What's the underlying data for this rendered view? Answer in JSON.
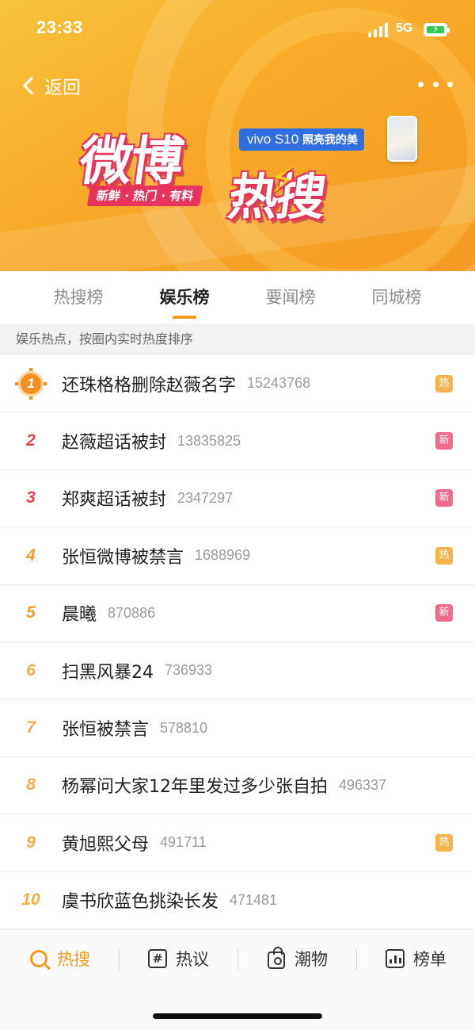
{
  "status_bar": {
    "time": "23:33",
    "network": "5G"
  },
  "header": {
    "back_label": "返回",
    "logo_text_1": "微博",
    "logo_text_2": "热搜",
    "logo_tagline": "新鲜 · 热门 · 有料",
    "ad_brand": "vivo S10",
    "ad_slogan": "照亮我的美"
  },
  "tabs": [
    {
      "label": "热搜榜",
      "active": false
    },
    {
      "label": "娱乐榜",
      "active": true
    },
    {
      "label": "要闻榜",
      "active": false
    },
    {
      "label": "同城榜",
      "active": false
    }
  ],
  "hint": "娱乐热点，按圈内实时热度排序",
  "list": [
    {
      "rank": "1",
      "title": "还珠格格删除赵薇名字",
      "count": "15243768",
      "badge": "热",
      "badge_type": "hot"
    },
    {
      "rank": "2",
      "title": "赵薇超话被封",
      "count": "13835825",
      "badge": "新",
      "badge_type": "new"
    },
    {
      "rank": "3",
      "title": "郑爽超话被封",
      "count": "2347297",
      "badge": "新",
      "badge_type": "new"
    },
    {
      "rank": "4",
      "title": "张恒微博被禁言",
      "count": "1688969",
      "badge": "热",
      "badge_type": "hot"
    },
    {
      "rank": "5",
      "title": "晨曦",
      "count": "870886",
      "badge": "新",
      "badge_type": "new"
    },
    {
      "rank": "6",
      "title": "扫黑风暴24",
      "count": "736933",
      "badge": "",
      "badge_type": ""
    },
    {
      "rank": "7",
      "title": "张恒被禁言",
      "count": "578810",
      "badge": "",
      "badge_type": ""
    },
    {
      "rank": "8",
      "title": "杨幂问大家12年里发过多少张自拍",
      "count": "496337",
      "badge": "",
      "badge_type": ""
    },
    {
      "rank": "9",
      "title": "黄旭熙父母",
      "count": "491711",
      "badge": "热",
      "badge_type": "hot"
    },
    {
      "rank": "10",
      "title": "虞书欣蓝色挑染长发",
      "count": "471481",
      "badge": "",
      "badge_type": ""
    }
  ],
  "bottom_nav": [
    {
      "label": "热搜",
      "icon": "search-icon",
      "active": true
    },
    {
      "label": "热议",
      "icon": "discussion-icon",
      "active": false
    },
    {
      "label": "潮物",
      "icon": "shopping-bag-icon",
      "active": false
    },
    {
      "label": "榜单",
      "icon": "chart-icon",
      "active": false
    }
  ],
  "colors": {
    "accent": "#f79a1a",
    "banner": "#f8a928",
    "hot_badge": "#f7b24b",
    "new_badge": "#f06a8c",
    "rank_top": "#e8414c"
  }
}
